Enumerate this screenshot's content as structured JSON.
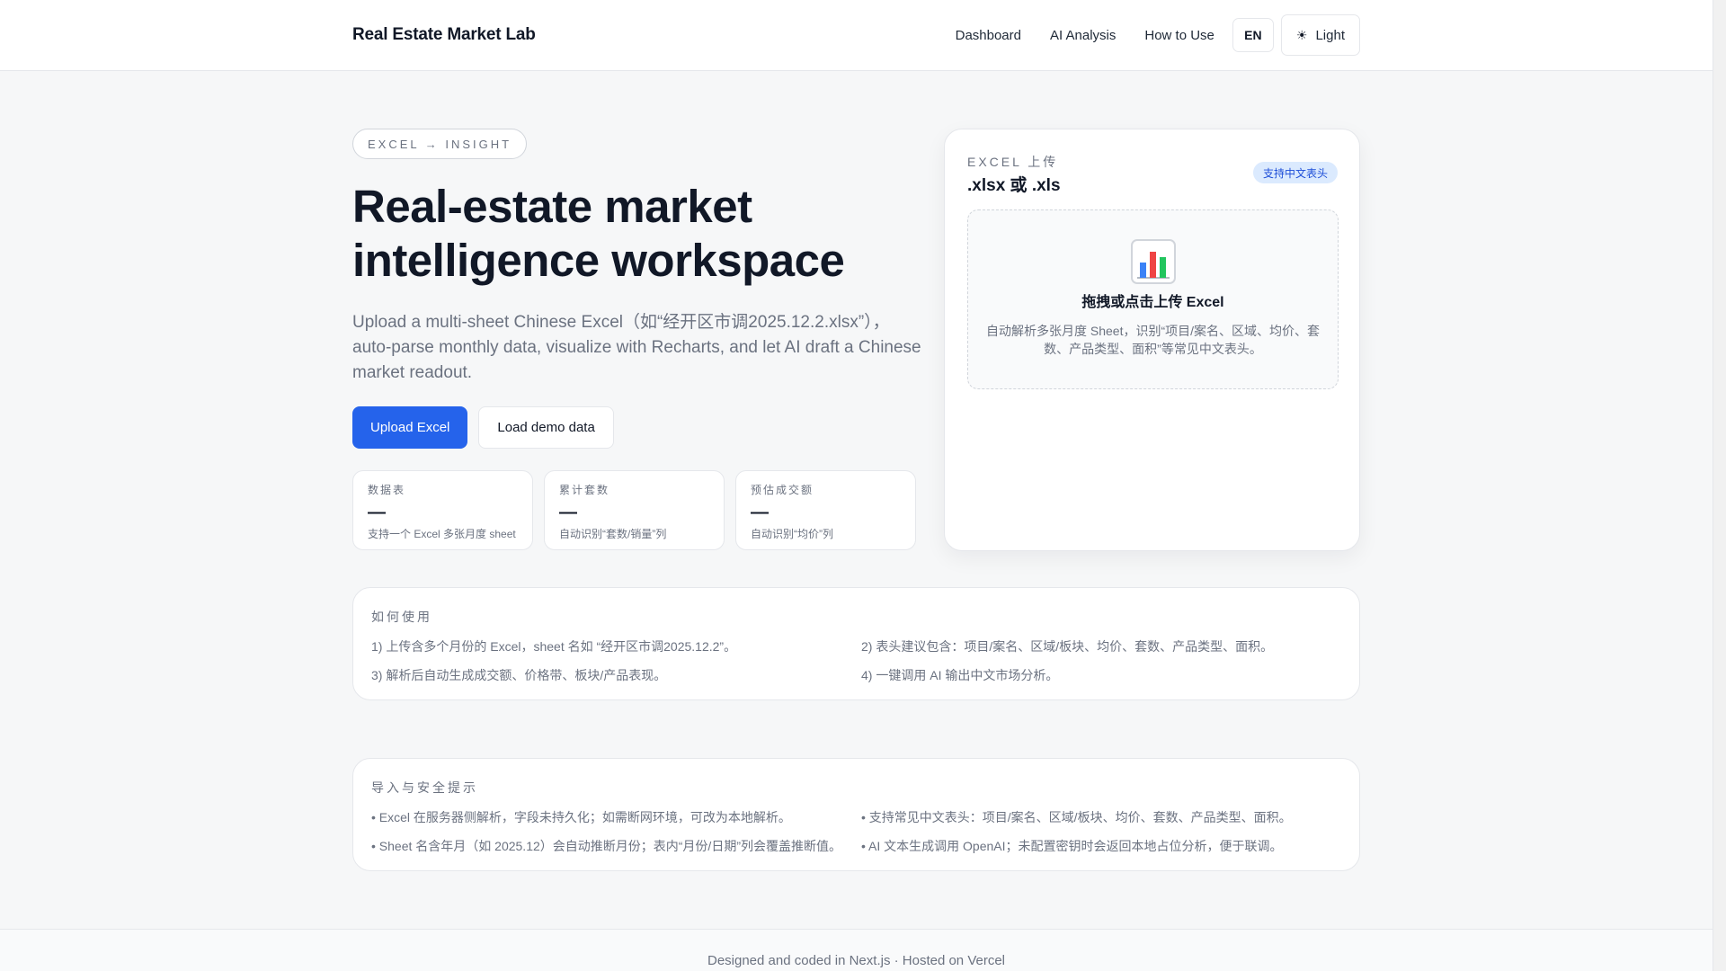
{
  "header": {
    "brand": "Real Estate Market Lab",
    "nav": [
      "Dashboard",
      "AI Analysis",
      "How to Use"
    ],
    "lang": "EN",
    "theme_label": "Light",
    "theme_icon": "☀"
  },
  "hero": {
    "pill": "EXCEL → INSIGHT",
    "title": "Real-estate market intelligence workspace",
    "description": "Upload a multi-sheet Chinese Excel（如“经开区市调2025.12.2.xlsx”）， auto-parse monthly data, visualize with Recharts, and let AI draft a Chinese market readout.",
    "upload_button": "Upload Excel",
    "demo_button": "Load demo data"
  },
  "stats": [
    {
      "label": "数据表",
      "value": "—",
      "hint": "支持一个 Excel 多张月度 sheet"
    },
    {
      "label": "累计套数",
      "value": "—",
      "hint": "自动识别“套数/销量”列"
    },
    {
      "label": "预估成交额",
      "value": "—",
      "hint": "自动识别“均价”列"
    }
  ],
  "upload": {
    "label": "EXCEL 上传",
    "formats": ".xlsx 或 .xls",
    "badge": "支持中文表头",
    "drop_title": "拖拽或点击上传 Excel",
    "drop_desc": "自动解析多张月度 Sheet，识别“项目/案名、区域、均价、套数、产品类型、面积”等常见中文表头。"
  },
  "howto": {
    "title": "如何使用",
    "items": [
      "1) 上传含多个月份的 Excel，sheet 名如 “经开区市调2025.12.2”。",
      "2) 表头建议包含：项目/案名、区域/板块、均价、套数、产品类型、面积。",
      "3) 解析后自动生成成交额、价格带、板块/产品表现。",
      "4) 一键调用 AI 输出中文市场分析。"
    ]
  },
  "safety": {
    "title": "导入与安全提示",
    "items": [
      "• Excel 在服务器侧解析，字段未持久化；如需断网环境，可改为本地解析。",
      "• 支持常见中文表头：项目/案名、区域/板块、均价、套数、产品类型、面积。",
      "• Sheet 名含年月（如 2025.12）会自动推断月份；表内“月份/日期”列会覆盖推断值。",
      "• AI 文本生成调用 OpenAI；未配置密钥时会返回本地占位分析，便于联调。"
    ]
  },
  "footer": {
    "text": "Designed and coded in Next.js · Hosted on Vercel"
  },
  "colors": {
    "primary": "#2563eb",
    "badge_bg": "#dbeafe",
    "badge_text": "#1d4ed8"
  },
  "icons": {
    "upload_illustration": "bar-chart-icon",
    "theme": "sun-icon"
  }
}
